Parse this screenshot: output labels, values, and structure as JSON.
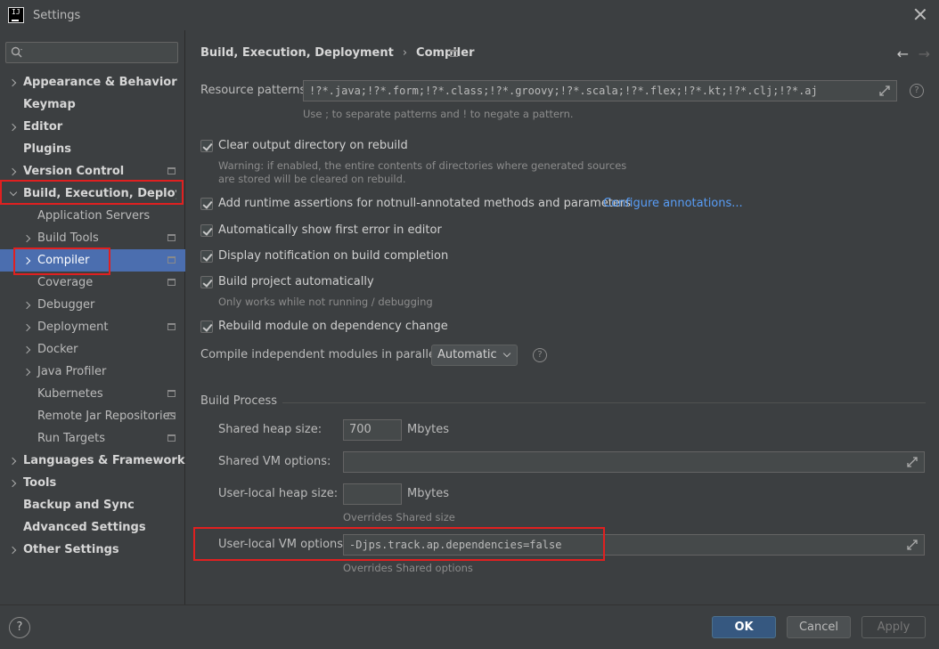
{
  "window": {
    "title": "Settings",
    "logo_text": "IJ"
  },
  "search": {
    "placeholder": ""
  },
  "sidebar": {
    "items": [
      {
        "label": "Appearance & Behavior"
      },
      {
        "label": "Keymap"
      },
      {
        "label": "Editor"
      },
      {
        "label": "Plugins"
      },
      {
        "label": "Version Control"
      },
      {
        "label": "Build, Execution, Deployment"
      },
      {
        "label": "Application Servers"
      },
      {
        "label": "Build Tools"
      },
      {
        "label": "Compiler"
      },
      {
        "label": "Coverage"
      },
      {
        "label": "Debugger"
      },
      {
        "label": "Deployment"
      },
      {
        "label": "Docker"
      },
      {
        "label": "Java Profiler"
      },
      {
        "label": "Kubernetes"
      },
      {
        "label": "Remote Jar Repositories"
      },
      {
        "label": "Run Targets"
      },
      {
        "label": "Languages & Frameworks"
      },
      {
        "label": "Tools"
      },
      {
        "label": "Backup and Sync"
      },
      {
        "label": "Advanced Settings"
      },
      {
        "label": "Other Settings"
      }
    ]
  },
  "breadcrumb": {
    "parent": "Build, Execution, Deployment",
    "separator": "›",
    "current": "Compiler"
  },
  "nav": {
    "back": "←",
    "forward": "→"
  },
  "compiler": {
    "resource_patterns_label": "Resource patterns:",
    "resource_patterns_value": "!?*.java;!?*.form;!?*.class;!?*.groovy;!?*.scala;!?*.flex;!?*.kt;!?*.clj;!?*.aj",
    "resource_patterns_hint": "Use ; to separate patterns and ! to negate a pattern.",
    "clear_output": "Clear output directory on rebuild",
    "clear_output_warning_1": "Warning: if enabled, the entire contents of directories where generated sources",
    "clear_output_warning_2": "are stored will be cleared on rebuild.",
    "runtime_assertions": "Add runtime assertions for notnull-annotated methods and parameters",
    "configure_annotations": "Configure annotations...",
    "show_first_error": "Automatically show first error in editor",
    "display_notification": "Display notification on build completion",
    "build_auto": "Build project automatically",
    "build_auto_hint": "Only works while not running / debugging",
    "rebuild_module": "Rebuild module on dependency change",
    "parallel_label": "Compile independent modules in parallel:",
    "parallel_value": "Automatic",
    "help_glyph": "?"
  },
  "build_process": {
    "title": "Build Process",
    "shared_heap_label": "Shared heap size:",
    "shared_heap_value": "700",
    "mbytes": "Mbytes",
    "shared_vm_label": "Shared VM options:",
    "shared_vm_value": "",
    "user_heap_label": "User-local heap size:",
    "user_heap_value": "",
    "user_heap_hint": "Overrides Shared size",
    "user_vm_label": "User-local VM options:",
    "user_vm_value": "-Djps.track.ap.dependencies=false",
    "user_vm_hint": "Overrides Shared options"
  },
  "footer": {
    "help": "?",
    "ok": "OK",
    "cancel": "Cancel",
    "apply": "Apply"
  },
  "colors": {
    "selection": "#4b6eaf",
    "highlight": "#e02020",
    "link": "#589df6",
    "primary": "#365880"
  }
}
